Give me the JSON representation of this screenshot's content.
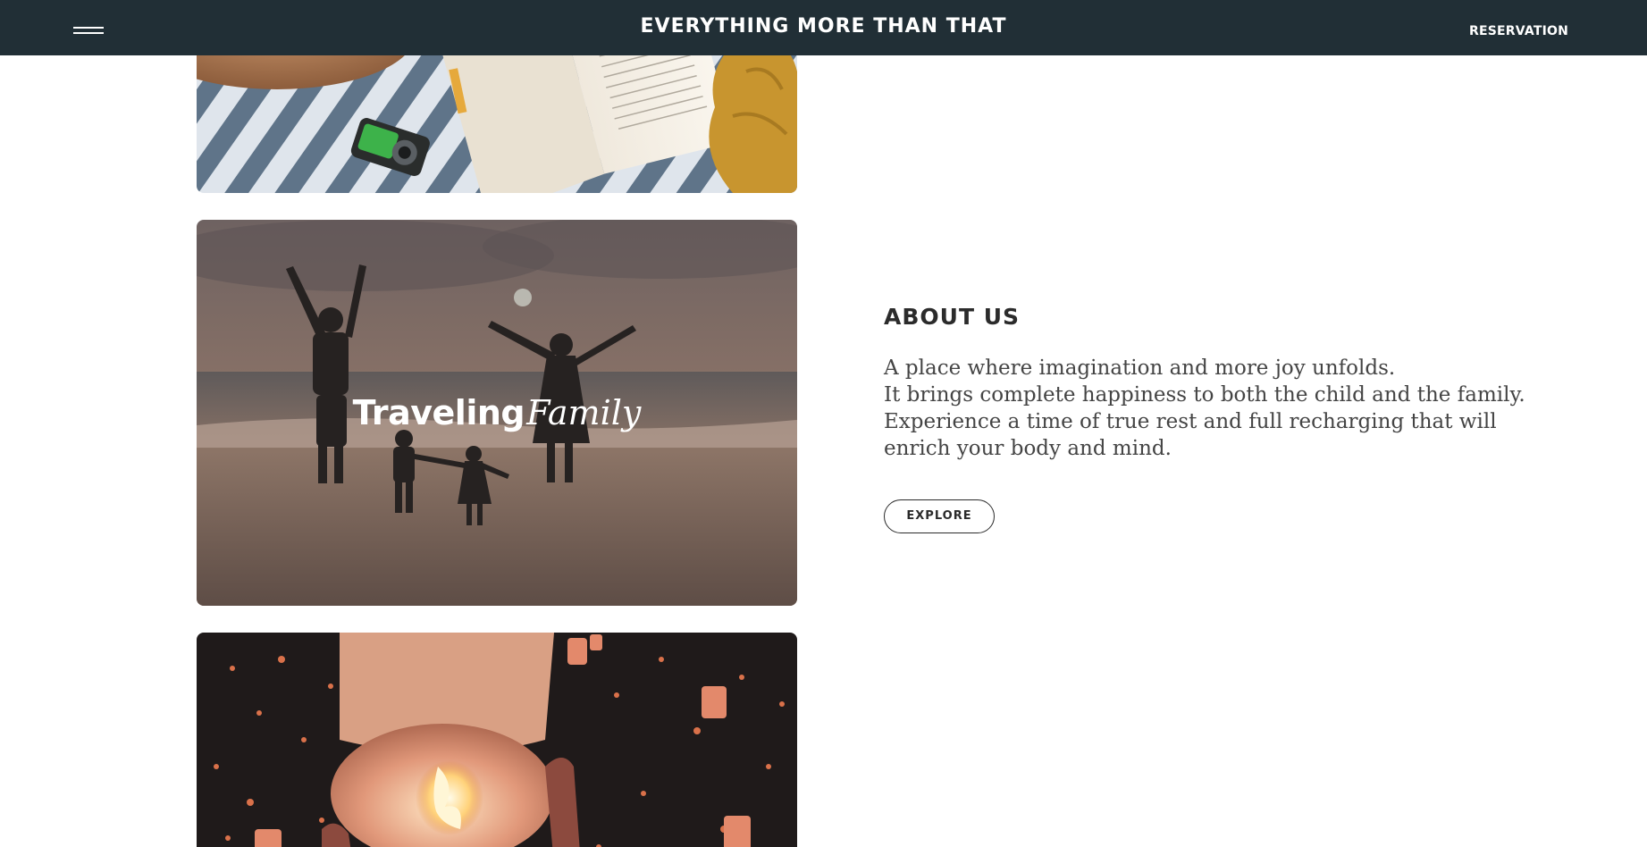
{
  "header": {
    "site_title": "EVERYTHING MORE THAN THAT",
    "reservation_label": "RESERVATION",
    "menu_icon": "hamburger-menu-icon",
    "background": "#212f36"
  },
  "cards": {
    "top_image": "picnic-book-camera-hat-photo",
    "family": {
      "image": "family-jumping-on-beach-at-sunset-photo",
      "title_strong": "Traveling",
      "title_italic": "Family"
    },
    "bottom_image": "sky-lanterns-at-night-photo"
  },
  "about": {
    "heading": "ABOUT US",
    "lines": [
      "A place where imagination and more joy unfolds.",
      "It brings complete happiness to both the child and the family.",
      "Experience a time of true rest and full recharging that will",
      "enrich your body and mind."
    ],
    "explore_label": "EXPLORE"
  }
}
